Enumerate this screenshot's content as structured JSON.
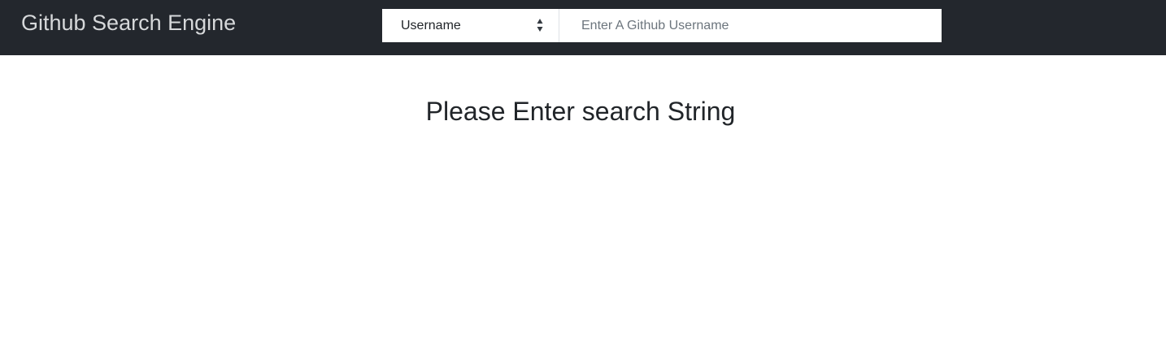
{
  "navbar": {
    "brand": "Github Search Engine",
    "background_color": "#23272d",
    "brand_color": "#d6d8da"
  },
  "search": {
    "type_select": {
      "selected": "Username",
      "icon": "select-arrows-icon"
    },
    "input": {
      "value": "",
      "placeholder": "Enter A Github Username"
    }
  },
  "main": {
    "message": "Please Enter search String"
  }
}
